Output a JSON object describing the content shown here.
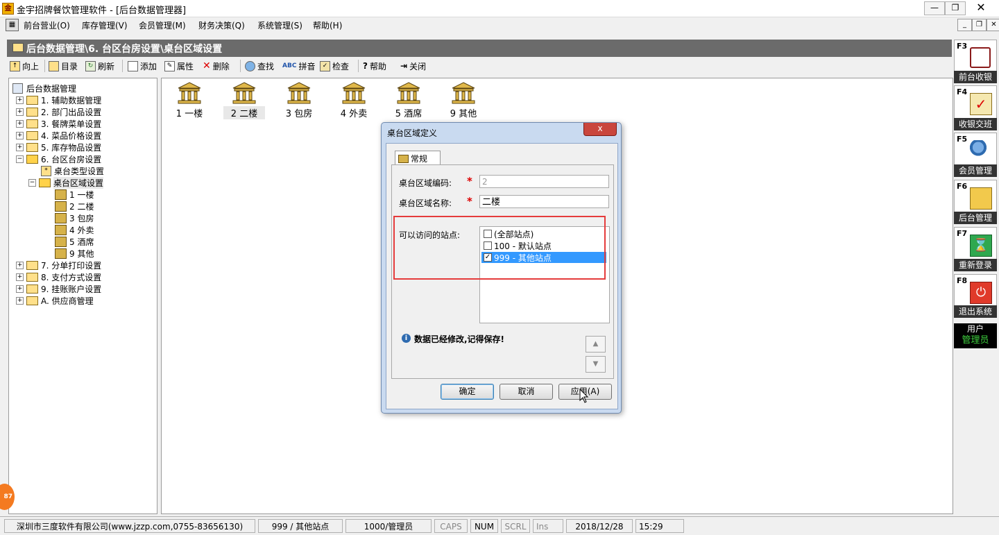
{
  "window": {
    "title": "金宇招牌餐饮管理软件 - [后台数据管理器]",
    "icon": "app-logo-icon",
    "controls": [
      "minimize-icon",
      "restore-icon",
      "close-icon"
    ]
  },
  "menu": [
    "前台营业(O)",
    "库存管理(V)",
    "会员管理(M)",
    "财务决策(Q)",
    "系统管理(S)",
    "帮助(H)"
  ],
  "breadcrumb": "后台数据管理\\6. 台区台房设置\\桌台区域设置",
  "toolbar": {
    "up": "向上",
    "catalog": "目录",
    "refresh": "刷新",
    "add": "添加",
    "properties": "属性",
    "delete": "删除",
    "find": "查找",
    "pinyin": "拼音",
    "check": "检查",
    "help": "帮助",
    "close": "关闭"
  },
  "tree": {
    "root": "后台数据管理",
    "n1": "1. 辅助数据管理",
    "n2": "2. 部门出品设置",
    "n3": "3. 餐牌菜单设置",
    "n4": "4. 菜品价格设置",
    "n5": "5. 库存物品设置",
    "n6": "6. 台区台房设置",
    "n6a": "桌台类型设置",
    "n6b": "桌台区域设置",
    "z1": "1 一楼",
    "z2": "2 二楼",
    "z3": "3 包房",
    "z4": "4 外卖",
    "z5": "5 酒席",
    "z9": "9 其他",
    "n7": "7. 分单打印设置",
    "n8": "8. 支付方式设置",
    "n9": "9. 挂账账户设置",
    "nA": "A. 供应商管理"
  },
  "zones": [
    "1 一楼",
    "2 二楼",
    "3 包房",
    "4 外卖",
    "5 酒席",
    "9 其他"
  ],
  "sidebar": {
    "f3": {
      "key": "F3",
      "label": "前台收银"
    },
    "f4": {
      "key": "F4",
      "label": "收银交班"
    },
    "f5": {
      "key": "F5",
      "label": "会员管理"
    },
    "f6": {
      "key": "F6",
      "label": "后台管理"
    },
    "f7": {
      "key": "F7",
      "label": "重新登录"
    },
    "f8": {
      "key": "F8",
      "label": "退出系统"
    },
    "user_label": "用户",
    "user_name": "管理员"
  },
  "dialog": {
    "title": "桌台区域定义",
    "close": "x",
    "tab": "常规",
    "code_label": "桌台区域编码:",
    "code_value": "2",
    "name_label": "桌台区域名称:",
    "name_value": "二楼",
    "sites_label": "可以访问的站点:",
    "sites": [
      {
        "label": "(全部站点)",
        "checked": false
      },
      {
        "label": "100 - 默认站点",
        "checked": false
      },
      {
        "label": "999 - 其他站点",
        "checked": true
      }
    ],
    "notice": "数据已经修改,记得保存!",
    "ok": "确定",
    "cancel": "取消",
    "apply": "应用(A)"
  },
  "status": {
    "company": "深圳市三度软件有限公司(www.jzzp.com,0755-83656130)",
    "site": "999 / 其他站点",
    "user": "1000/管理员",
    "caps": "CAPS",
    "num": "NUM",
    "scrl": "SCRL",
    "ins": "Ins",
    "date": "2018/12/28",
    "time": "15:29"
  },
  "badge": "87",
  "colors": {
    "accent": "#3399ff",
    "highlight_frame": "#e53b3b",
    "breadcrumb_bg": "#6b6b6b",
    "dialog_bg": "#c9daf0"
  }
}
